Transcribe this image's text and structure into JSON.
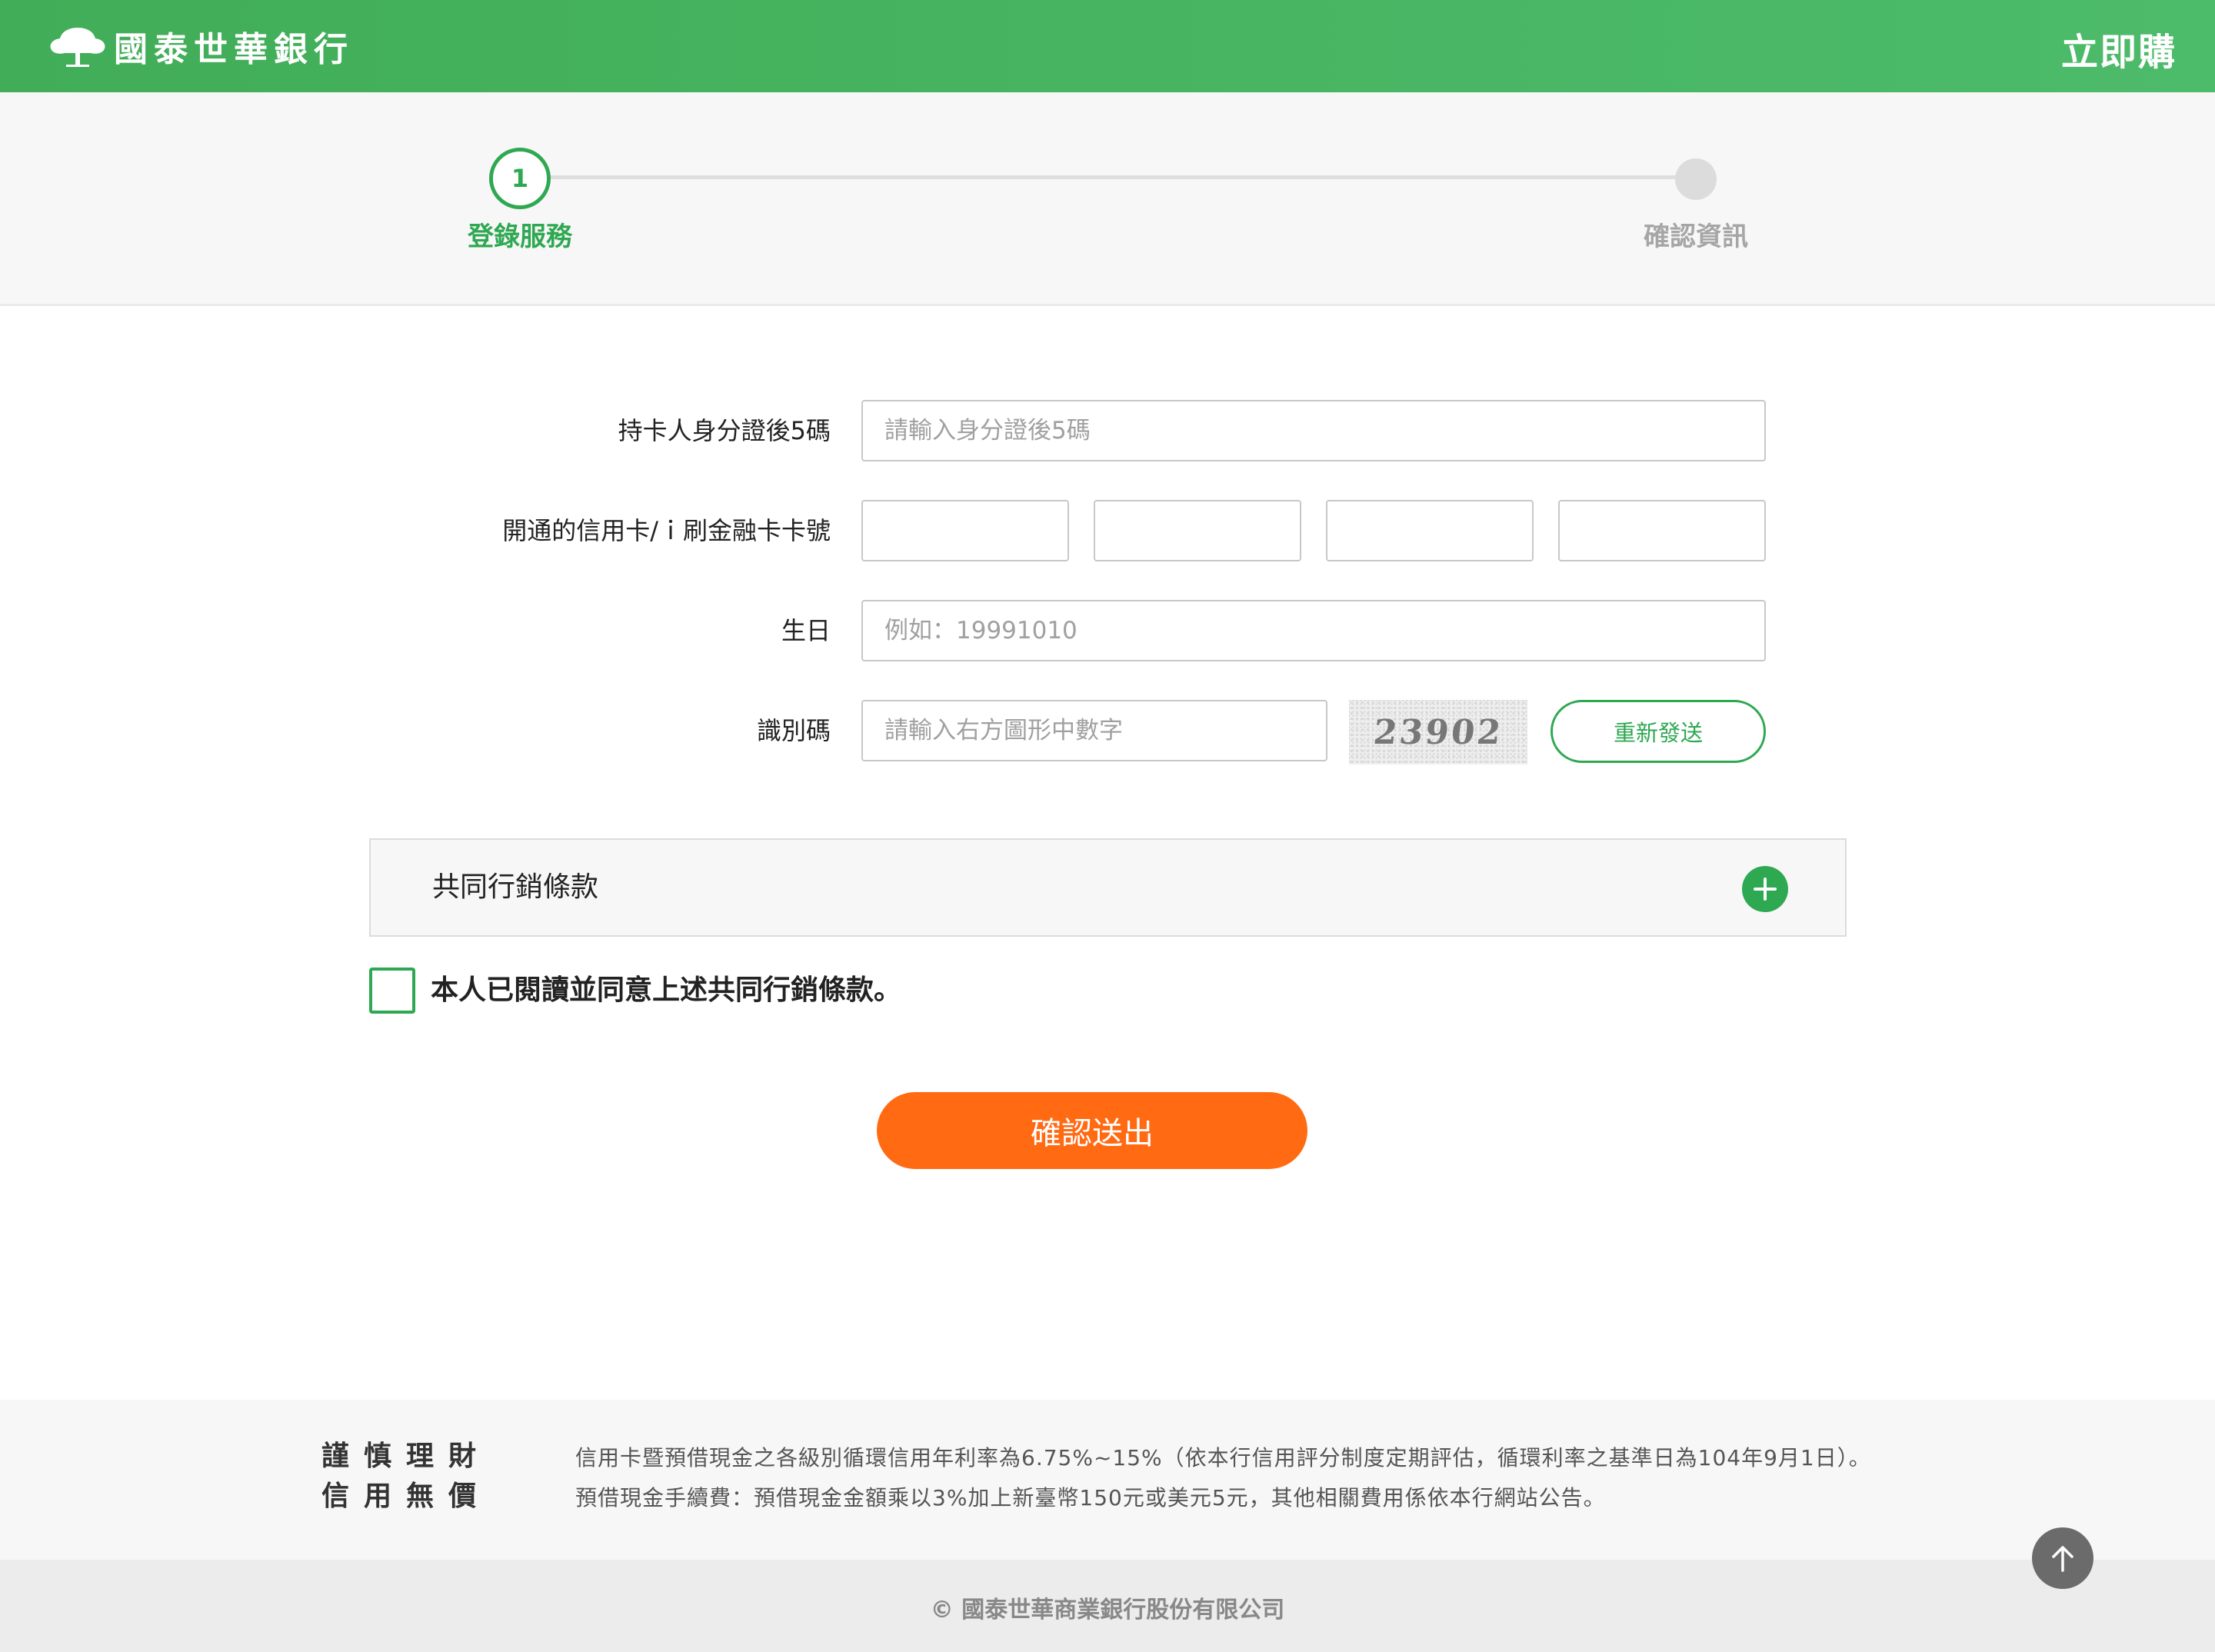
{
  "header": {
    "logo_text": "國泰世華銀行",
    "action_label": "立即購"
  },
  "stepper": {
    "step1_number": "1",
    "step1_label": "登錄服務",
    "step2_label": "確認資訊"
  },
  "form": {
    "id_label": "持卡人身分證後5碼",
    "id_placeholder": "請輸入身分證後5碼",
    "card_label": "開通的信用卡/ｉ刷金融卡卡號",
    "birthday_label": "生日",
    "birthday_placeholder": "例如：19991010",
    "captcha_label": "識別碼",
    "captcha_placeholder": "請輸入右方圖形中數字",
    "captcha_image_text": "23902",
    "resend_label": "重新發送"
  },
  "terms": {
    "title": "共同行銷條款",
    "agree_text": "本人已閱讀並同意上述共同行銷條款。"
  },
  "submit_label": "確認送出",
  "footer": {
    "slogan_line1": "謹慎理財",
    "slogan_line2": "信用無價",
    "notice_line1": "信用卡暨預借現金之各級別循環信用年利率為6.75%~15%（依本行信用評分制度定期評估，循環利率之基準日為104年9月1日）。",
    "notice_line2": "預借現金手續費：預借現金金額乘以3%加上新臺幣150元或美元5元，其他相關費用係依本行網站公告。",
    "copyright": "© 國泰世華商業銀行股份有限公司"
  },
  "colors": {
    "brand_green": "#2fa852",
    "submit_orange": "#ff6a13"
  },
  "icons": {
    "logo": "tree-icon",
    "expand": "plus-icon",
    "back_to_top": "arrow-up-icon"
  }
}
